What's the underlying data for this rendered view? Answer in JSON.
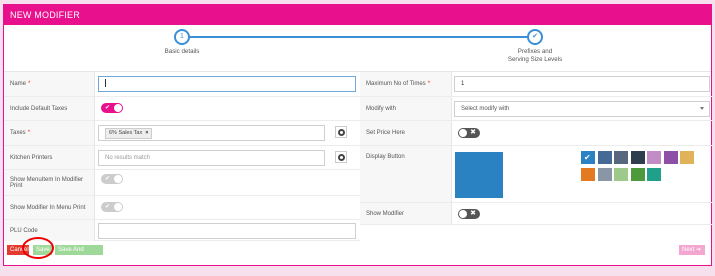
{
  "header": {
    "title": "NEW MODIFIER"
  },
  "stepper": {
    "steps": [
      {
        "number": "1",
        "label": "Basic details",
        "state": "current"
      },
      {
        "number": "✔",
        "label_line1": "Prefixes and",
        "label_line2": "Serving Size Levels",
        "state": "complete"
      }
    ],
    "accent_color": "#3b8fd6"
  },
  "form_left": {
    "name": {
      "label": "Name",
      "required": "*",
      "value": ""
    },
    "include_default_taxes": {
      "label": "Include Default Taxes",
      "state": "on"
    },
    "taxes": {
      "label": "Taxes",
      "required": "*",
      "tag": "6% Sales Tax",
      "remove_glyph": "×"
    },
    "kitchen_printers": {
      "label": "Kitchen Printers",
      "placeholder": "No results match"
    },
    "show_menuitem": {
      "label_line1": "Show MenuItem In Modifier",
      "label_line2": "Print",
      "state": "disabled-on"
    },
    "show_modifier_menu": {
      "label": "Show Modifier In Menu Print",
      "state": "disabled-on"
    },
    "plu_code": {
      "label": "PLU Code",
      "value": ""
    }
  },
  "form_right": {
    "max_times": {
      "label": "Maximum No of Times",
      "required": "*",
      "value": "1"
    },
    "modify_with": {
      "label": "Modify with",
      "placeholder": "Select modify with"
    },
    "set_price_here": {
      "label": "Set Price Here",
      "state": "off"
    },
    "display_button": {
      "label": "Display Button",
      "preview_color": "#2b82c3",
      "swatches_row1": [
        "#2b82c3",
        "#456a96",
        "#56677e",
        "#2e3e4e",
        "#c28dc6",
        "#8e4fa6",
        "#e0b25a"
      ],
      "swatches_row2": [
        "#e37a21",
        "#8896a6",
        "#9ec98a",
        "#4c9a3b",
        "#20a08a"
      ],
      "selected_swatch": "#2b82c3"
    },
    "show_modifier": {
      "label": "Show Modifier",
      "state": "off"
    }
  },
  "footer": {
    "cancel": "Cancel",
    "save": "Save",
    "save_publish": "Save And Publish",
    "next": "Next ➔"
  },
  "colors": {
    "brand": "#e8108c",
    "cancel": "#e33b2f",
    "save": "#9fd99a",
    "next": "#f3a6cf"
  }
}
